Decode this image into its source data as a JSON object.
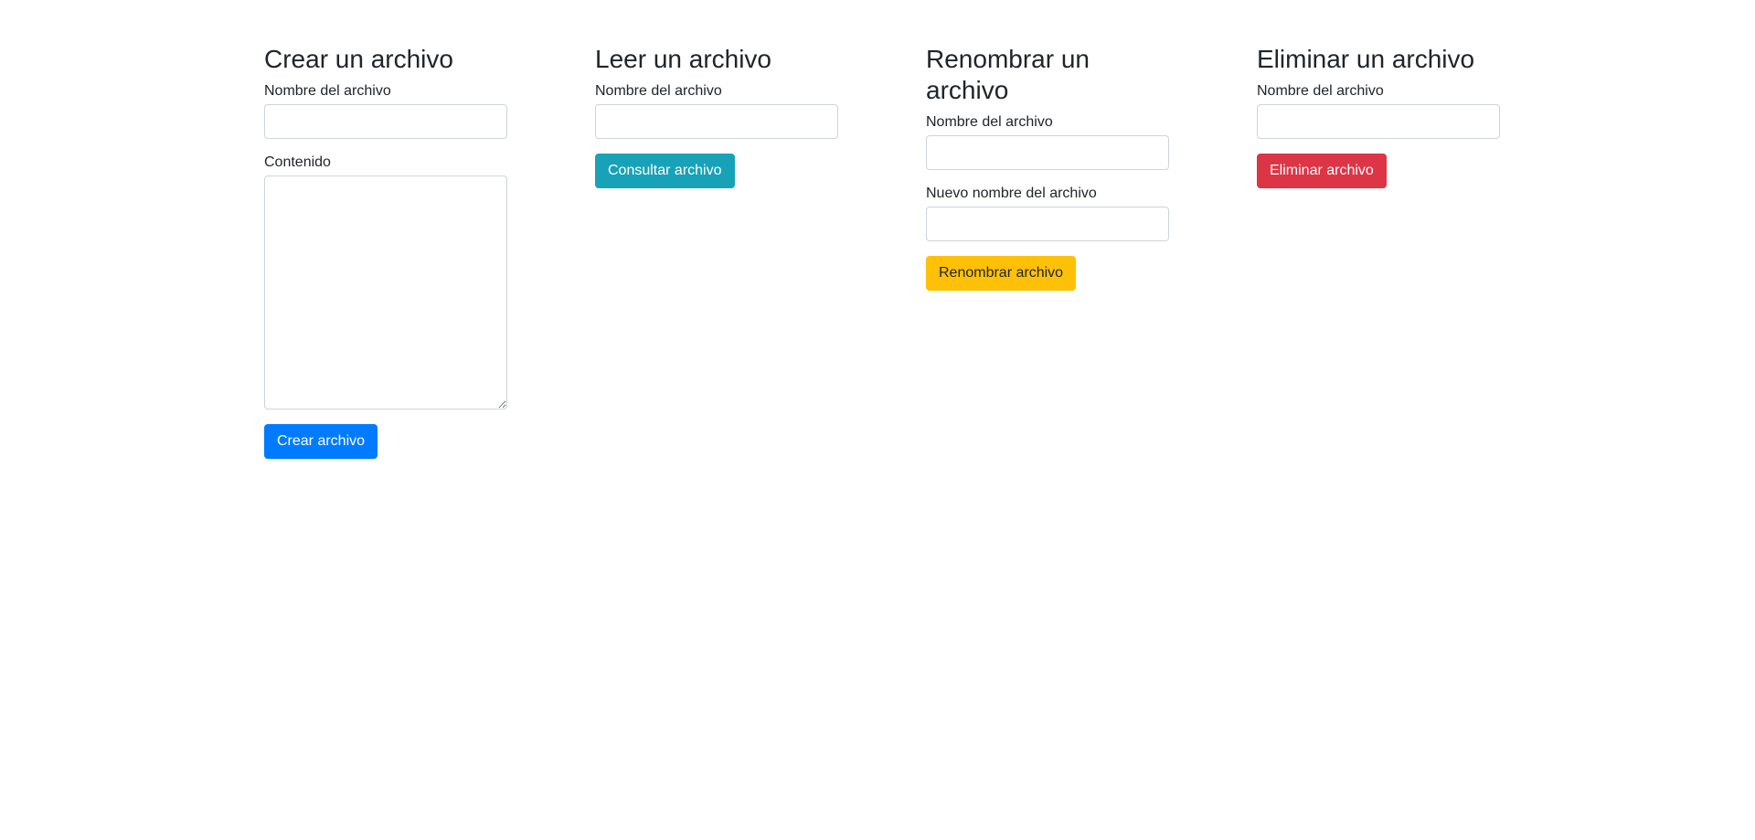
{
  "create": {
    "title": "Crear un archivo",
    "filename_label": "Nombre del archivo",
    "filename_value": "",
    "content_label": "Contenido",
    "content_value": "",
    "button_label": "Crear archivo",
    "button_color": "#007bff"
  },
  "read": {
    "title": "Leer un archivo",
    "filename_label": "Nombre del archivo",
    "filename_value": "",
    "button_label": "Consultar archivo",
    "button_color": "#17a2b8"
  },
  "rename": {
    "title": "Renombrar un archivo",
    "filename_label": "Nombre del archivo",
    "filename_value": "",
    "new_filename_label": "Nuevo nombre del archivo",
    "new_filename_value": "",
    "button_label": "Renombrar archivo",
    "button_color": "#ffc107"
  },
  "delete": {
    "title": "Eliminar un archivo",
    "filename_label": "Nombre del archivo",
    "filename_value": "",
    "button_label": "Eliminar archivo",
    "button_color": "#dc3545"
  }
}
